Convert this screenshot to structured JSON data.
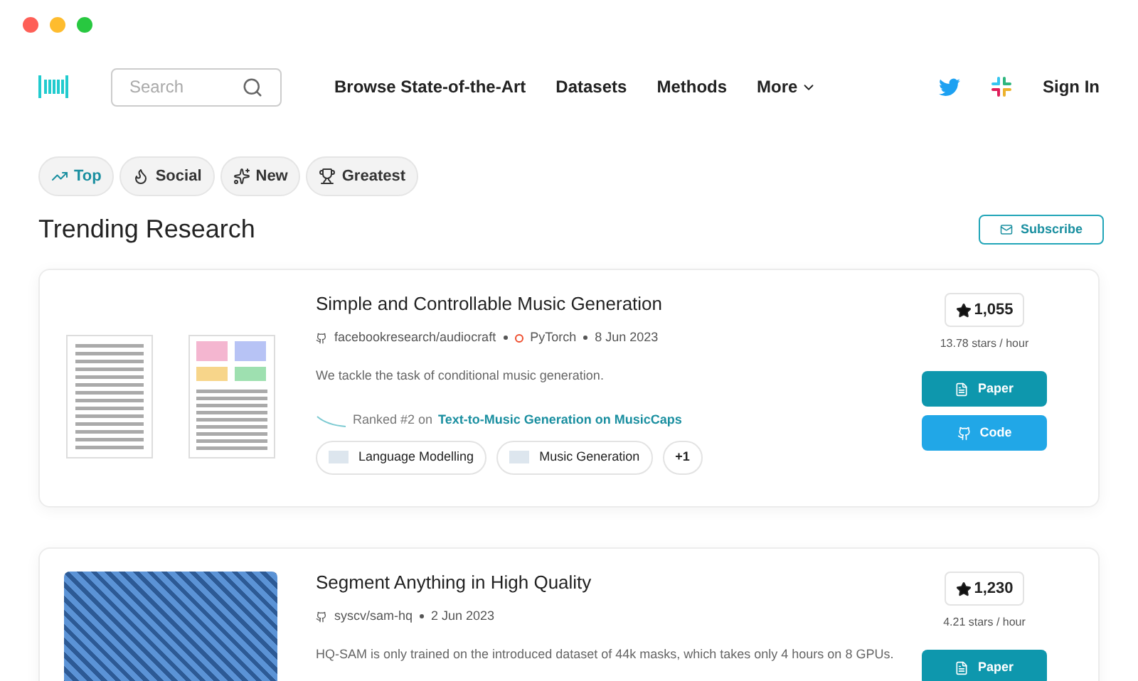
{
  "nav": {
    "search": {
      "placeholder": "Search"
    },
    "links": [
      "Browse State-of-the-Art",
      "Datasets",
      "Methods"
    ],
    "more": "More",
    "sign_in": "Sign In"
  },
  "filters": [
    {
      "label": "Top",
      "selected": true
    },
    {
      "label": "Social",
      "selected": false
    },
    {
      "label": "New",
      "selected": false
    },
    {
      "label": "Greatest",
      "selected": false
    }
  ],
  "heading": "Trending Research",
  "subscribe": "Subscribe",
  "papers": [
    {
      "kind": "pages",
      "title": "Simple and Controllable Music Generation",
      "repo": "facebookresearch/audiocraft",
      "framework": "PyTorch",
      "date": "8 Jun 2023",
      "abstract": "We tackle the task of conditional music generation.",
      "rank": {
        "prefix": "Ranked #2 on",
        "link": "Text-to-Music Generation on MusicCaps"
      },
      "tasks": [
        "Language Modelling",
        "Music Generation"
      ],
      "more_tasks": "+1",
      "stars": "1,055",
      "rate": "13.78 stars / hour",
      "buttons": [
        {
          "kind": "paper",
          "label": "Paper"
        },
        {
          "kind": "code",
          "label": "Code"
        }
      ]
    },
    {
      "kind": "photo",
      "title": "Segment Anything in High Quality",
      "repo": "syscv/sam-hq",
      "date": "2 Jun 2023",
      "abstract": "HQ-SAM is only trained on the introduced dataset of 44k masks, which takes only 4 hours on 8 GPUs.",
      "stars": "1,230",
      "rate": "4.21 stars / hour",
      "buttons": [
        {
          "kind": "paper",
          "label": "Paper"
        }
      ]
    }
  ]
}
